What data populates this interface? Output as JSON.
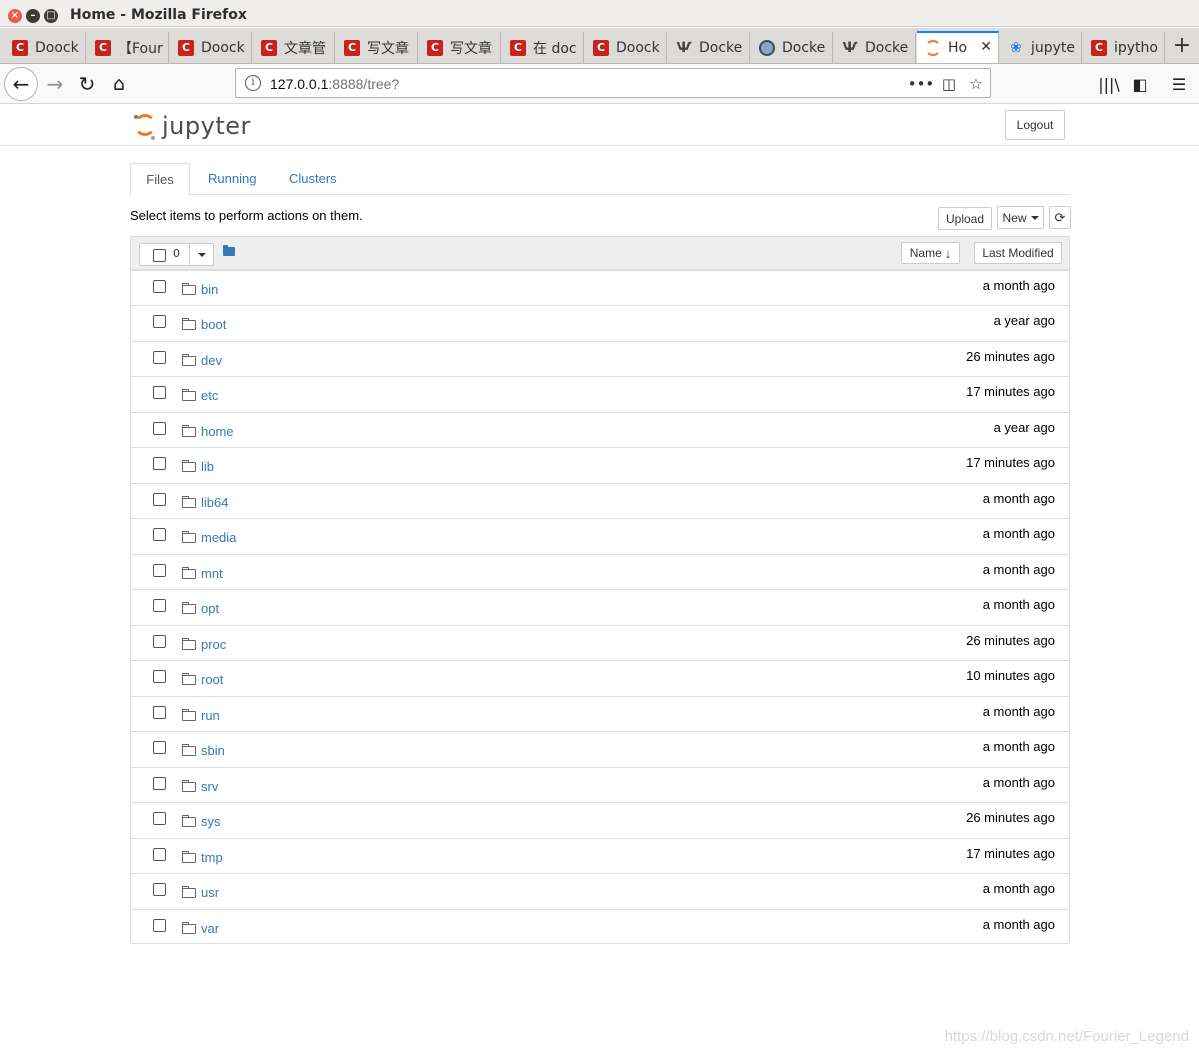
{
  "window": {
    "title": "Home - Mozilla Firefox"
  },
  "tabs": [
    {
      "label": "Doock",
      "icon": "csdn-icon"
    },
    {
      "label": "【Four",
      "icon": "csdn-icon"
    },
    {
      "label": "Doock",
      "icon": "csdn-icon"
    },
    {
      "label": "文章管",
      "icon": "csdn-icon"
    },
    {
      "label": "写文章",
      "icon": "csdn-icon"
    },
    {
      "label": "写文章",
      "icon": "csdn-icon"
    },
    {
      "label": "在 doc",
      "icon": "csdn-icon"
    },
    {
      "label": "Doock",
      "icon": "csdn-icon"
    },
    {
      "label": "Docke",
      "icon": "docker-icon"
    },
    {
      "label": "Docke",
      "icon": "globe-icon"
    },
    {
      "label": "Docke",
      "icon": "docker-icon"
    },
    {
      "label": "Ho",
      "icon": "jupyter-icon",
      "active": true
    },
    {
      "label": "jupyte",
      "icon": "paw-icon"
    },
    {
      "label": "ipytho",
      "icon": "csdn-icon"
    }
  ],
  "nav": {
    "url_host": "127.0.0.1",
    "url_rest": ":8888/tree?"
  },
  "jupyter": {
    "logo_text": "jupyter",
    "logout_label": "Logout",
    "tabs": {
      "files": "Files",
      "running": "Running",
      "clusters": "Clusters"
    },
    "instructions": "Select items to perform actions on them.",
    "upload_label": "Upload",
    "new_label": "New",
    "selected_count": "0",
    "sort_name_label": "Name",
    "sort_modified_label": "Last Modified",
    "files": [
      {
        "name": "bin",
        "modified": "a month ago"
      },
      {
        "name": "boot",
        "modified": "a year ago"
      },
      {
        "name": "dev",
        "modified": "26 minutes ago"
      },
      {
        "name": "etc",
        "modified": "17 minutes ago"
      },
      {
        "name": "home",
        "modified": "a year ago"
      },
      {
        "name": "lib",
        "modified": "17 minutes ago"
      },
      {
        "name": "lib64",
        "modified": "a month ago"
      },
      {
        "name": "media",
        "modified": "a month ago"
      },
      {
        "name": "mnt",
        "modified": "a month ago"
      },
      {
        "name": "opt",
        "modified": "a month ago"
      },
      {
        "name": "proc",
        "modified": "26 minutes ago"
      },
      {
        "name": "root",
        "modified": "10 minutes ago"
      },
      {
        "name": "run",
        "modified": "a month ago"
      },
      {
        "name": "sbin",
        "modified": "a month ago"
      },
      {
        "name": "srv",
        "modified": "a month ago"
      },
      {
        "name": "sys",
        "modified": "26 minutes ago"
      },
      {
        "name": "tmp",
        "modified": "17 minutes ago"
      },
      {
        "name": "usr",
        "modified": "a month ago"
      },
      {
        "name": "var",
        "modified": "a month ago"
      }
    ]
  },
  "watermark": "https://blog.csdn.net/Fourier_Legend",
  "colors": {
    "link": "#337ab7",
    "jupyter_orange": "#f37726",
    "firefox_accent": "#0a84ff"
  }
}
